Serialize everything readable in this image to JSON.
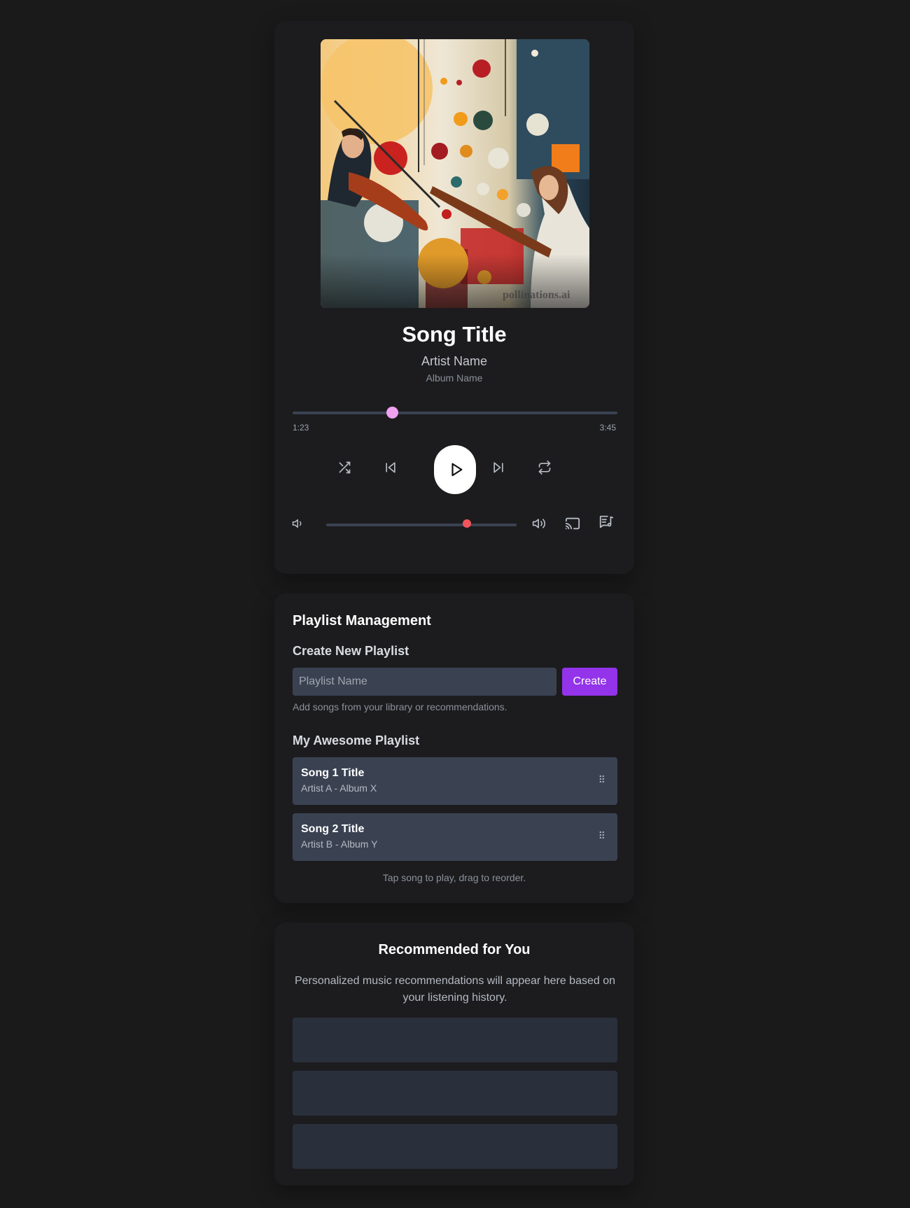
{
  "player": {
    "song_title": "Song Title",
    "artist_name": "Artist Name",
    "album_name": "Album Name",
    "album_art_watermark": "pollinations.ai",
    "progress": {
      "current_time": "1:23",
      "total_time": "3:45",
      "fraction": 0.305
    },
    "volume": {
      "fraction": 0.74
    },
    "colors": {
      "progress_thumb": "#f0a2f0",
      "volume_thumb": "#f2545b",
      "play_button": "#ffffff"
    },
    "icons": [
      "shuffle-icon",
      "previous-icon",
      "play-icon",
      "next-icon",
      "repeat-icon",
      "volume-low-icon",
      "volume-high-icon",
      "cast-icon",
      "lyrics-icon"
    ]
  },
  "playlist": {
    "heading": "Playlist Management",
    "create_heading": "Create New Playlist",
    "input_placeholder": "Playlist Name",
    "create_label": "Create",
    "create_hint": "Add songs from your library or recommendations.",
    "list_name": "My Awesome Playlist",
    "songs": [
      {
        "title": "Song 1 Title",
        "meta": "Artist A - Album X"
      },
      {
        "title": "Song 2 Title",
        "meta": "Artist B - Album Y"
      }
    ],
    "drag_glyph": "⠿",
    "footer_hint": "Tap song to play, drag to reorder.",
    "accent": "#9333ea"
  },
  "recommendations": {
    "heading": "Recommended for You",
    "description": "Personalized music recommendations will appear here based on your listening history.",
    "placeholder_count": 3
  }
}
